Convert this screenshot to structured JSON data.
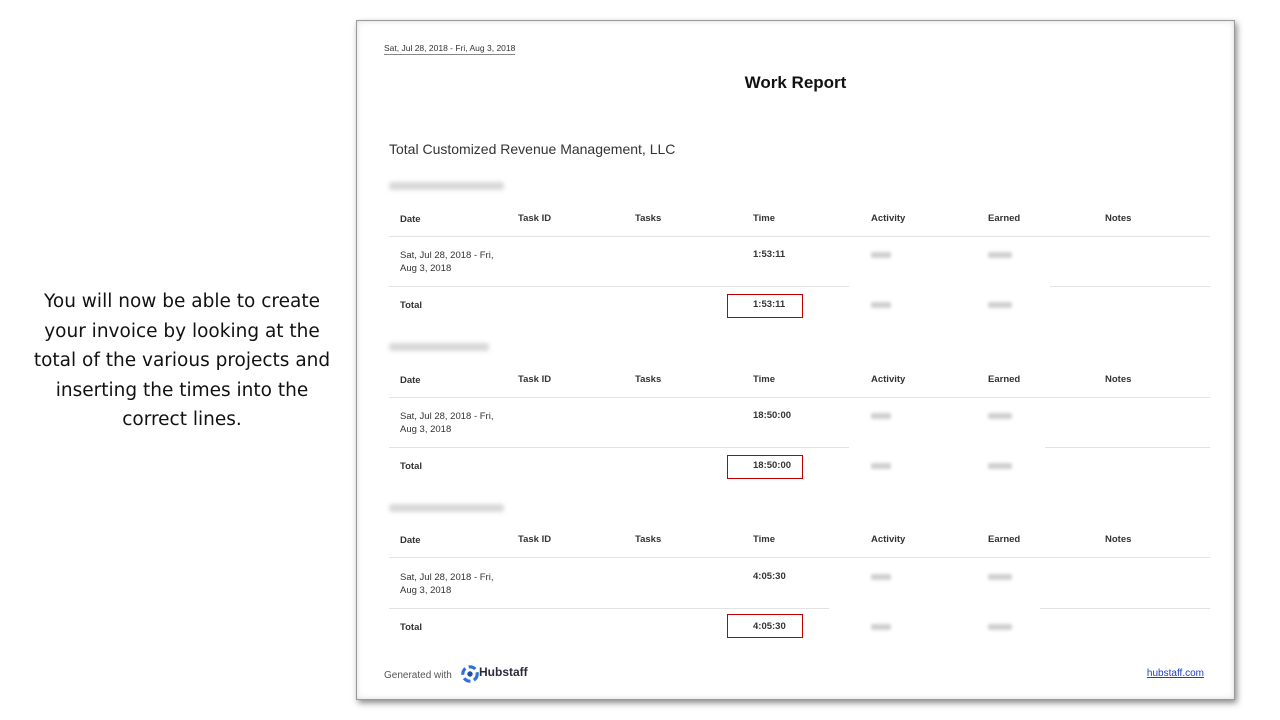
{
  "caption": "You will now be able to create your invoice by looking at the total of the various projects and inserting the times into the correct lines.",
  "report": {
    "date_range": "Sat, Jul 28, 2018 - Fri, Aug 3, 2018",
    "title": "Work Report",
    "company": "Total Customized Revenue Management, LLC",
    "columns": [
      "Date",
      "Task ID",
      "Tasks",
      "Time",
      "Activity",
      "Earned",
      "Notes"
    ],
    "sections": [
      {
        "row_date_line1": "Sat, Jul 28, 2018 - Fri,",
        "row_date_line2": "Aug 3, 2018",
        "row_time": "1:53:11",
        "total_label": "Total",
        "total_time": "1:53:11"
      },
      {
        "row_date_line1": "Sat, Jul 28, 2018 - Fri,",
        "row_date_line2": "Aug 3, 2018",
        "row_time": "18:50:00",
        "total_label": "Total",
        "total_time": "18:50:00"
      },
      {
        "row_date_line1": "Sat, Jul 28, 2018 - Fri,",
        "row_date_line2": "Aug 3, 2018",
        "row_time": "4:05:30",
        "total_label": "Total",
        "total_time": "4:05:30"
      }
    ]
  },
  "footer": {
    "generated_with": "Generated with",
    "brand": "Hubstaff",
    "link": "hubstaff.com"
  },
  "colors": {
    "highlight_border": "#c00000",
    "link": "#1a3fbf"
  }
}
